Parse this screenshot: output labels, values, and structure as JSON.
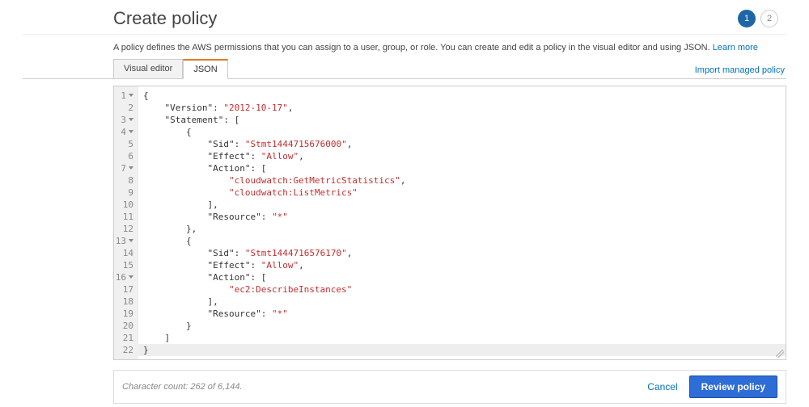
{
  "header": {
    "title": "Create policy",
    "steps": [
      "1",
      "2"
    ],
    "active_step": 0
  },
  "description": {
    "text": "A policy defines the AWS permissions that you can assign to a user, group, or role. You can create and edit a policy in the visual editor and using JSON. ",
    "learn_more": "Learn more"
  },
  "tabs": {
    "visual": "Visual editor",
    "json": "JSON",
    "import_link": "Import managed policy"
  },
  "editor": {
    "last_line": 22,
    "json_raw": "{\n    \"Version\": \"2012-10-17\",\n    \"Statement\": [\n        {\n            \"Sid\": \"Stmt1444715676000\",\n            \"Effect\": \"Allow\",\n            \"Action\": [\n                \"cloudwatch:GetMetricStatistics\",\n                \"cloudwatch:ListMetrics\"\n            ],\n            \"Resource\": \"*\"\n        },\n        {\n            \"Sid\": \"Stmt1444716576170\",\n            \"Effect\": \"Allow\",\n            \"Action\": [\n                \"ec2:DescribeInstances\"\n            ],\n            \"Resource\": \"*\"\n        }\n    ]\n}",
    "policy": {
      "Version": "2012-10-17",
      "Statement": [
        {
          "Sid": "Stmt1444715676000",
          "Effect": "Allow",
          "Action": [
            "cloudwatch:GetMetricStatistics",
            "cloudwatch:ListMetrics"
          ],
          "Resource": "*"
        },
        {
          "Sid": "Stmt1444716576170",
          "Effect": "Allow",
          "Action": [
            "ec2:DescribeInstances"
          ],
          "Resource": "*"
        }
      ]
    }
  },
  "footer": {
    "char_count": "Character count: 262 of 6,144.",
    "cancel": "Cancel",
    "review": "Review policy"
  }
}
